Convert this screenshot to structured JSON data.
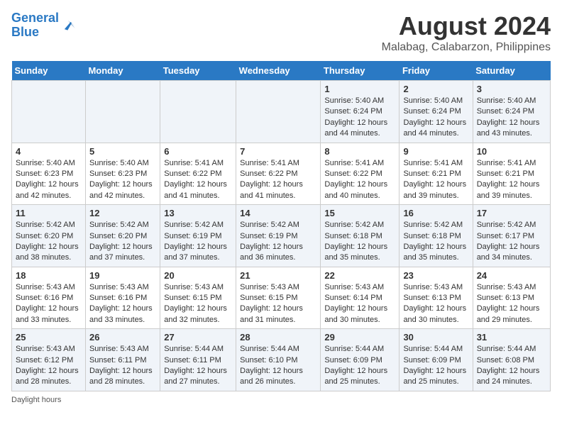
{
  "header": {
    "logo_line1": "General",
    "logo_line2": "Blue",
    "title": "August 2024",
    "subtitle": "Malabag, Calabarzon, Philippines"
  },
  "days_of_week": [
    "Sunday",
    "Monday",
    "Tuesday",
    "Wednesday",
    "Thursday",
    "Friday",
    "Saturday"
  ],
  "weeks": [
    [
      {
        "day": "",
        "text": ""
      },
      {
        "day": "",
        "text": ""
      },
      {
        "day": "",
        "text": ""
      },
      {
        "day": "",
        "text": ""
      },
      {
        "day": "1",
        "text": "Sunrise: 5:40 AM\nSunset: 6:24 PM\nDaylight: 12 hours and 44 minutes."
      },
      {
        "day": "2",
        "text": "Sunrise: 5:40 AM\nSunset: 6:24 PM\nDaylight: 12 hours and 44 minutes."
      },
      {
        "day": "3",
        "text": "Sunrise: 5:40 AM\nSunset: 6:24 PM\nDaylight: 12 hours and 43 minutes."
      }
    ],
    [
      {
        "day": "4",
        "text": "Sunrise: 5:40 AM\nSunset: 6:23 PM\nDaylight: 12 hours and 42 minutes."
      },
      {
        "day": "5",
        "text": "Sunrise: 5:40 AM\nSunset: 6:23 PM\nDaylight: 12 hours and 42 minutes."
      },
      {
        "day": "6",
        "text": "Sunrise: 5:41 AM\nSunset: 6:22 PM\nDaylight: 12 hours and 41 minutes."
      },
      {
        "day": "7",
        "text": "Sunrise: 5:41 AM\nSunset: 6:22 PM\nDaylight: 12 hours and 41 minutes."
      },
      {
        "day": "8",
        "text": "Sunrise: 5:41 AM\nSunset: 6:22 PM\nDaylight: 12 hours and 40 minutes."
      },
      {
        "day": "9",
        "text": "Sunrise: 5:41 AM\nSunset: 6:21 PM\nDaylight: 12 hours and 39 minutes."
      },
      {
        "day": "10",
        "text": "Sunrise: 5:41 AM\nSunset: 6:21 PM\nDaylight: 12 hours and 39 minutes."
      }
    ],
    [
      {
        "day": "11",
        "text": "Sunrise: 5:42 AM\nSunset: 6:20 PM\nDaylight: 12 hours and 38 minutes."
      },
      {
        "day": "12",
        "text": "Sunrise: 5:42 AM\nSunset: 6:20 PM\nDaylight: 12 hours and 37 minutes."
      },
      {
        "day": "13",
        "text": "Sunrise: 5:42 AM\nSunset: 6:19 PM\nDaylight: 12 hours and 37 minutes."
      },
      {
        "day": "14",
        "text": "Sunrise: 5:42 AM\nSunset: 6:19 PM\nDaylight: 12 hours and 36 minutes."
      },
      {
        "day": "15",
        "text": "Sunrise: 5:42 AM\nSunset: 6:18 PM\nDaylight: 12 hours and 35 minutes."
      },
      {
        "day": "16",
        "text": "Sunrise: 5:42 AM\nSunset: 6:18 PM\nDaylight: 12 hours and 35 minutes."
      },
      {
        "day": "17",
        "text": "Sunrise: 5:42 AM\nSunset: 6:17 PM\nDaylight: 12 hours and 34 minutes."
      }
    ],
    [
      {
        "day": "18",
        "text": "Sunrise: 5:43 AM\nSunset: 6:16 PM\nDaylight: 12 hours and 33 minutes."
      },
      {
        "day": "19",
        "text": "Sunrise: 5:43 AM\nSunset: 6:16 PM\nDaylight: 12 hours and 33 minutes."
      },
      {
        "day": "20",
        "text": "Sunrise: 5:43 AM\nSunset: 6:15 PM\nDaylight: 12 hours and 32 minutes."
      },
      {
        "day": "21",
        "text": "Sunrise: 5:43 AM\nSunset: 6:15 PM\nDaylight: 12 hours and 31 minutes."
      },
      {
        "day": "22",
        "text": "Sunrise: 5:43 AM\nSunset: 6:14 PM\nDaylight: 12 hours and 30 minutes."
      },
      {
        "day": "23",
        "text": "Sunrise: 5:43 AM\nSunset: 6:13 PM\nDaylight: 12 hours and 30 minutes."
      },
      {
        "day": "24",
        "text": "Sunrise: 5:43 AM\nSunset: 6:13 PM\nDaylight: 12 hours and 29 minutes."
      }
    ],
    [
      {
        "day": "25",
        "text": "Sunrise: 5:43 AM\nSunset: 6:12 PM\nDaylight: 12 hours and 28 minutes."
      },
      {
        "day": "26",
        "text": "Sunrise: 5:43 AM\nSunset: 6:11 PM\nDaylight: 12 hours and 28 minutes."
      },
      {
        "day": "27",
        "text": "Sunrise: 5:44 AM\nSunset: 6:11 PM\nDaylight: 12 hours and 27 minutes."
      },
      {
        "day": "28",
        "text": "Sunrise: 5:44 AM\nSunset: 6:10 PM\nDaylight: 12 hours and 26 minutes."
      },
      {
        "day": "29",
        "text": "Sunrise: 5:44 AM\nSunset: 6:09 PM\nDaylight: 12 hours and 25 minutes."
      },
      {
        "day": "30",
        "text": "Sunrise: 5:44 AM\nSunset: 6:09 PM\nDaylight: 12 hours and 25 minutes."
      },
      {
        "day": "31",
        "text": "Sunrise: 5:44 AM\nSunset: 6:08 PM\nDaylight: 12 hours and 24 minutes."
      }
    ]
  ],
  "footer": {
    "daylight_label": "Daylight hours"
  },
  "colors": {
    "header_bg": "#2a79c4",
    "odd_row_bg": "#f0f4f9",
    "even_row_bg": "#ffffff"
  }
}
